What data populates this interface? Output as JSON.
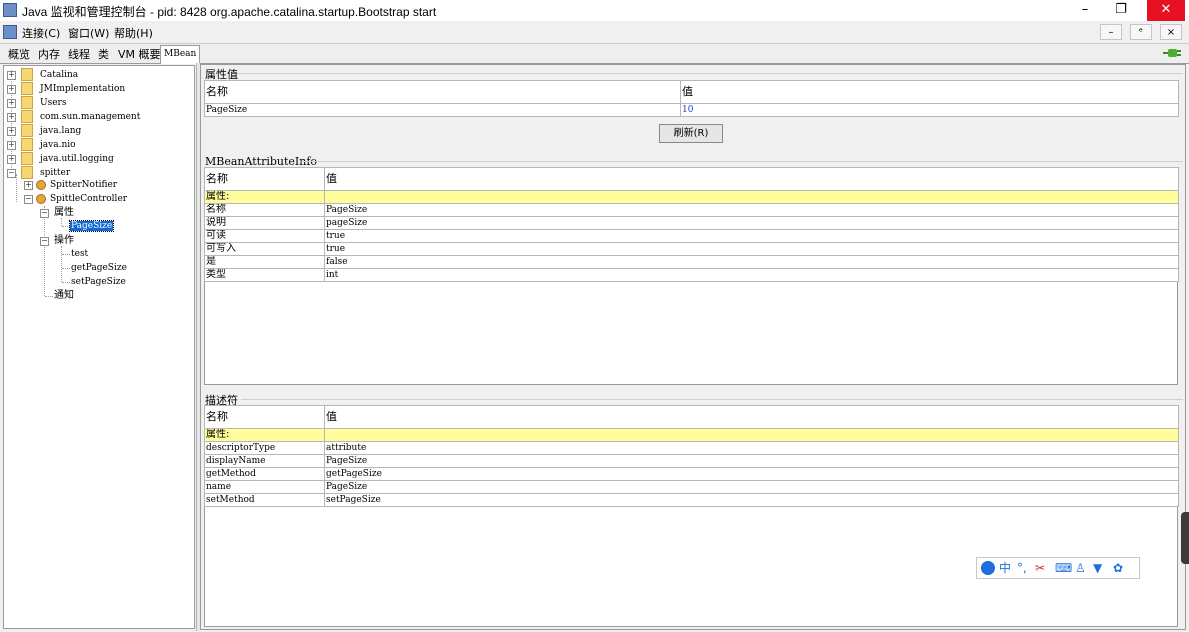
{
  "window": {
    "title": "Java 监视和管理控制台 - pid: 8428 org.apache.catalina.startup.Bootstrap start",
    "minimize": "–",
    "restore": "❐",
    "close": "✕"
  },
  "menubar": {
    "items": [
      "连接(C)",
      "窗口(W)",
      "帮助(H)"
    ],
    "inner_min": "–",
    "inner_restore": "ᵉ",
    "inner_close": "×"
  },
  "tabs": [
    "概览",
    "内存",
    "线程",
    "类",
    "VM 概要",
    "MBean"
  ],
  "tree": {
    "domains": [
      "Catalina",
      "JMImplementation",
      "Users",
      "com.sun.management",
      "java.lang",
      "java.nio",
      "java.util.logging",
      "spitter"
    ],
    "spitter_children": [
      "SpitterNotifier",
      "SpittleController"
    ],
    "attributes_label": "属性",
    "selected_attribute": "PageSize",
    "operations_label": "操作",
    "operations": [
      "test",
      "getPageSize",
      "setPageSize"
    ],
    "notifications_label": "通知"
  },
  "attribute_values": {
    "section_title": "属性值",
    "col_name": "名称",
    "col_value": "值",
    "rows": [
      {
        "name": "PageSize",
        "value": "10"
      }
    ],
    "refresh_button": "刷新(R)"
  },
  "attribute_info": {
    "section_title": "MBeanAttributeInfo",
    "col_name": "名称",
    "col_value": "值",
    "group": "属性:",
    "rows": [
      {
        "name": "名称",
        "value": "PageSize"
      },
      {
        "name": "说明",
        "value": "pageSize"
      },
      {
        "name": "可读",
        "value": "true"
      },
      {
        "name": "可写入",
        "value": "true"
      },
      {
        "name": "是",
        "value": "false"
      },
      {
        "name": "类型",
        "value": "int"
      }
    ]
  },
  "descriptor": {
    "section_title": "描述符",
    "col_name": "名称",
    "col_value": "值",
    "group": "属性:",
    "rows": [
      {
        "name": "descriptorType",
        "value": "attribute"
      },
      {
        "name": "displayName",
        "value": "PageSize"
      },
      {
        "name": "getMethod",
        "value": "getPageSize"
      },
      {
        "name": "name",
        "value": "PageSize"
      },
      {
        "name": "setMethod",
        "value": "setPageSize"
      }
    ]
  },
  "ime_toolbar": {
    "icons": [
      "user-icon",
      "chinese-mode-icon",
      "punctuation-icon",
      "scissors-icon",
      "keyboard-icon",
      "person-icon",
      "shirt-icon",
      "gear-icon"
    ],
    "chinese_mode": "中",
    "punctuation": "°,"
  },
  "colors": {
    "selection": "#0f6ad8",
    "header_yellow": "#fffd9c",
    "close_red": "#e81123",
    "value_blue": "#1f3fbf"
  }
}
